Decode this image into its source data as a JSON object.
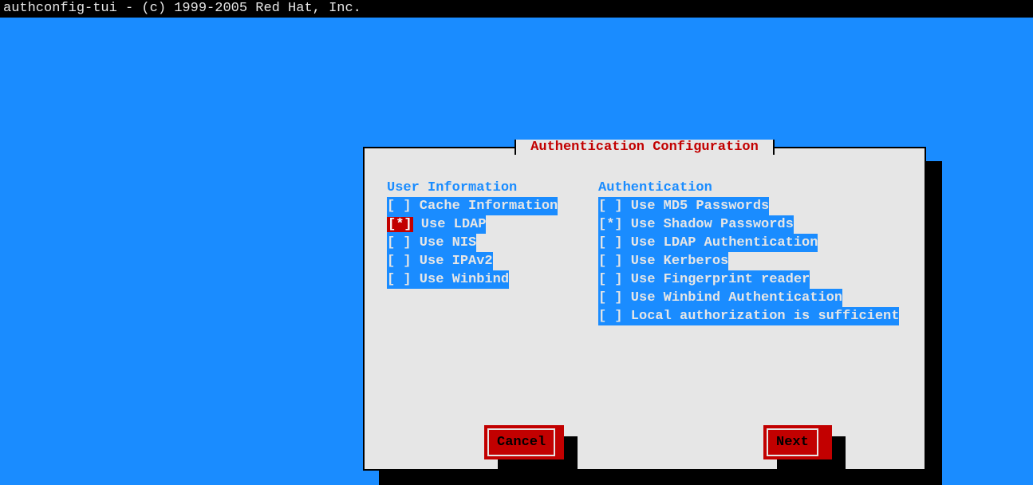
{
  "topbar": "authconfig-tui - (c) 1999-2005 Red Hat, Inc.",
  "dialog": {
    "title": " Authentication Configuration ",
    "left": {
      "header": "User Information",
      "items": [
        {
          "checked": false,
          "label": "Cache Information",
          "focused": false
        },
        {
          "checked": true,
          "label": "Use LDAP",
          "focused": true
        },
        {
          "checked": false,
          "label": "Use NIS",
          "focused": false
        },
        {
          "checked": false,
          "label": "Use IPAv2",
          "focused": false
        },
        {
          "checked": false,
          "label": "Use Winbind",
          "focused": false
        }
      ]
    },
    "right": {
      "header": "Authentication",
      "items": [
        {
          "checked": false,
          "label": "Use MD5 Passwords"
        },
        {
          "checked": true,
          "label": "Use Shadow Passwords"
        },
        {
          "checked": false,
          "label": "Use LDAP Authentication"
        },
        {
          "checked": false,
          "label": "Use Kerberos"
        },
        {
          "checked": false,
          "label": "Use Fingerprint reader"
        },
        {
          "checked": false,
          "label": "Use Winbind Authentication"
        },
        {
          "checked": false,
          "label": "Local authorization is sufficient"
        }
      ]
    },
    "buttons": {
      "cancel": "Cancel",
      "next": "Next"
    }
  }
}
